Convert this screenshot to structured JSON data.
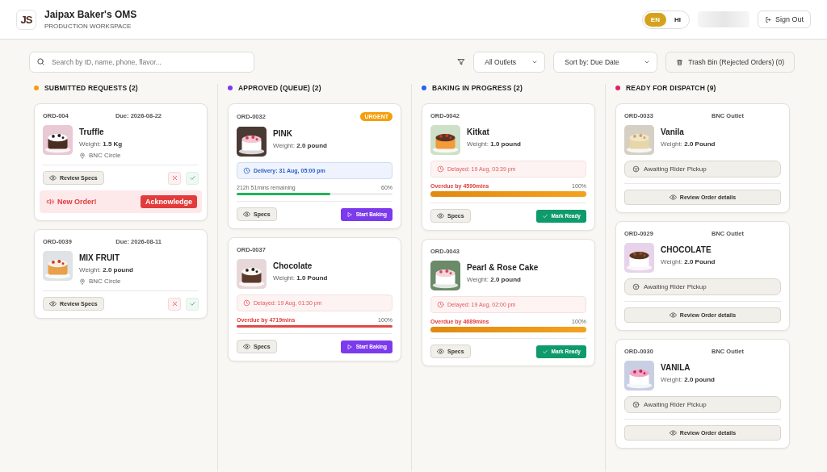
{
  "header": {
    "logo": "JS",
    "title": "Jaipax Baker's OMS",
    "subtitle": "PRODUCTION WORKSPACE",
    "languages": [
      {
        "label": "EN",
        "selected": true
      },
      {
        "label": "HI",
        "selected": false
      }
    ],
    "sign_out": "Sign Out"
  },
  "toolbar": {
    "search": {
      "placeholder": "Search by ID, name, phone, flavor..."
    },
    "outlet_select": "All Outlets",
    "sort_select": "Sort by: Due Date",
    "trash_button": "Trash Bin (Rejected Orders) (0)"
  },
  "columns": [
    {
      "kind": "submitted",
      "title": "SUBMITTED REQUESTS (2)",
      "color": "#f59e0b",
      "cards": [
        {
          "id": "ORD-004",
          "due": "Due: 2026-08-22",
          "name": "Truffle",
          "weight": "Weight: **1.5 Kg**",
          "location": "BNC Circle",
          "specs_button": "Review Specs",
          "alert": {
            "text": "New Order!",
            "action": "Acknowledge"
          }
        },
        {
          "id": "ORD-0039",
          "due": "Due: 2026-08-11",
          "name": "MIX FRUIT",
          "weight": "Weight: **2.0 pound**",
          "location": "BNC Circle",
          "specs_button": "Review Specs"
        }
      ]
    },
    {
      "kind": "approved",
      "title": "APPROVED (QUEUE) (2)",
      "color": "#7c3aed",
      "cards": [
        {
          "id": "ORD-0032",
          "badge": "URGENT",
          "name": "PINK",
          "weight": "Weight: **2.0 pound**",
          "timing": {
            "kind": "delivery",
            "text": "Delivery: 31 Aug, 05:00 pm"
          },
          "progress": {
            "kind": "on_time",
            "label": "212h 51mins remaining",
            "percent": "60%",
            "level": 0.6
          },
          "specs_button": "Specs",
          "action_button": "Start Baking"
        },
        {
          "id": "ORD-0037",
          "name": "Chocolate",
          "weight": "Weight: **1.0 Pound**",
          "timing": {
            "kind": "delayed",
            "text": "Delayed: 19 Aug, 01:30 pm"
          },
          "progress": {
            "kind": "overdue",
            "label": "Overdue by 4719mins",
            "percent": "100%",
            "level": 1
          },
          "specs_button": "Specs",
          "action_button": "Start Baking"
        }
      ]
    },
    {
      "kind": "baking",
      "title": "BAKING IN PROGRESS (2)",
      "color": "#2563eb",
      "cards": [
        {
          "id": "ORD-0042",
          "name": "Kitkat",
          "weight": "Weight: **1.0 pound**",
          "timing": {
            "kind": "delayed",
            "text": "Delayed: 19 Aug, 03:39 pm"
          },
          "progress": {
            "kind": "baking",
            "label": "Overdue by 4590mins",
            "percent": "100%",
            "level": 1
          },
          "specs_button": "Specs",
          "action_button": "Mark Ready"
        },
        {
          "id": "ORD-0043",
          "name": "Pearl & Rose Cake",
          "weight": "Weight: **2.0 pound**",
          "timing": {
            "kind": "delayed",
            "text": "Delayed: 19 Aug, 02:00 pm"
          },
          "progress": {
            "kind": "baking",
            "label": "Overdue by 4689mins",
            "percent": "100%",
            "level": 1
          },
          "specs_button": "Specs",
          "action_button": "Mark Ready"
        }
      ]
    },
    {
      "kind": "ready",
      "title": "READY FOR DISPATCH (9)",
      "color": "#e11d68",
      "cards": [
        {
          "id": "ORD-0033",
          "outlet": "BNC Outlet",
          "name": "Vanila",
          "weight": "Weight: **2.0 Pound**",
          "status": "Awaiting Rider Pickup",
          "details_button": "Review Order details"
        },
        {
          "id": "ORD-0029",
          "outlet": "BNC Outlet",
          "name": "CHOCOLATE",
          "weight": "Weight: **2.0 Pound**",
          "status": "Awaiting Rider Pickup",
          "details_button": "Review Order details"
        },
        {
          "id": "ORD-0030",
          "outlet": "BNC Outlet",
          "name": "VANILA",
          "weight": "Weight: **2.0 pound**",
          "status": "Awaiting Rider Pickup",
          "details_button": "Review Order details"
        }
      ]
    }
  ]
}
